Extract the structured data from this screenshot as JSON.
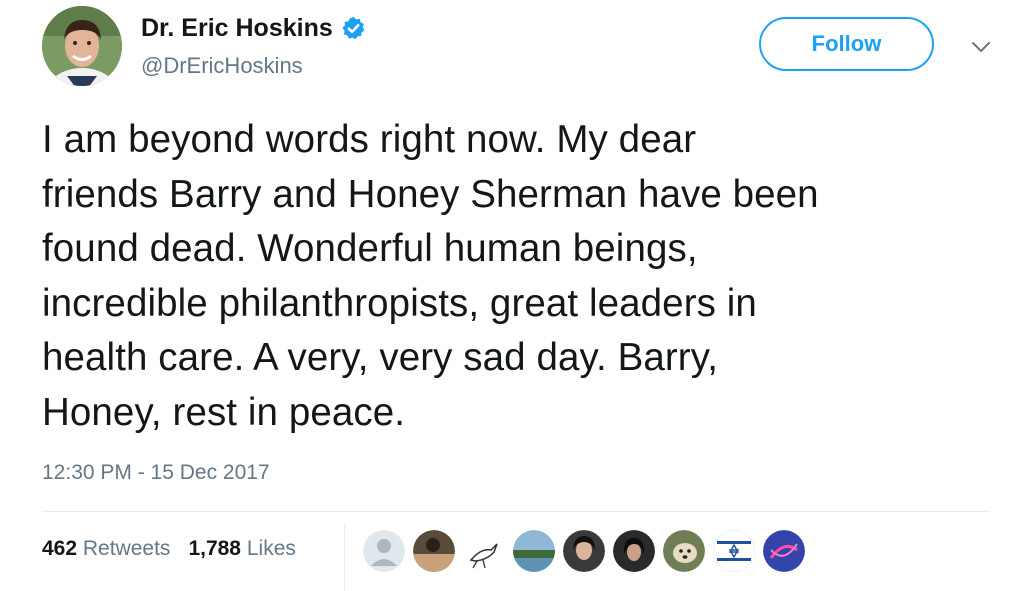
{
  "user": {
    "display_name": "Dr. Eric Hoskins",
    "handle": "@DrEricHoskins",
    "avatar_icon": "profile-photo-avatar",
    "verified_icon": "verified-badge-icon",
    "verified_color": "#1da1f2"
  },
  "actions": {
    "follow_label": "Follow",
    "more_icon": "chevron-down-icon"
  },
  "tweet": {
    "lines": [
      "I am beyond words right now. My dear",
      "friends Barry and Honey Sherman have been",
      "found dead. Wonderful human beings,",
      "incredible philanthropists, great leaders in",
      "health care. A very, very sad day. Barry,",
      "Honey, rest in peace."
    ],
    "timestamp": "12:30 PM - 15 Dec 2017"
  },
  "stats": {
    "retweets_count": "462",
    "retweets_label": "Retweets",
    "likes_count": "1,788",
    "likes_label": "Likes"
  },
  "likers": [
    {
      "icon": "default-avatar-icon",
      "color": "#aab8c2"
    },
    {
      "icon": "user-avatar-icon",
      "color": "#5a4a3a"
    },
    {
      "icon": "bird-drawing-avatar-icon",
      "color": "#ffffff"
    },
    {
      "icon": "landscape-avatar-icon",
      "color": "#6aa0c0"
    },
    {
      "icon": "user-avatar-icon",
      "color": "#3a3a3a"
    },
    {
      "icon": "user-avatar-icon",
      "color": "#2a2a2a"
    },
    {
      "icon": "dog-avatar-icon",
      "color": "#8a7a60"
    },
    {
      "icon": "israel-flag-avatar-icon",
      "color": "#1f4fa0"
    },
    {
      "icon": "abstract-avatar-icon",
      "color": "#3344aa"
    }
  ],
  "colors": {
    "accent": "#1da1f2",
    "text": "#14171a",
    "muted": "#657786",
    "divider": "#e6ecf0"
  }
}
